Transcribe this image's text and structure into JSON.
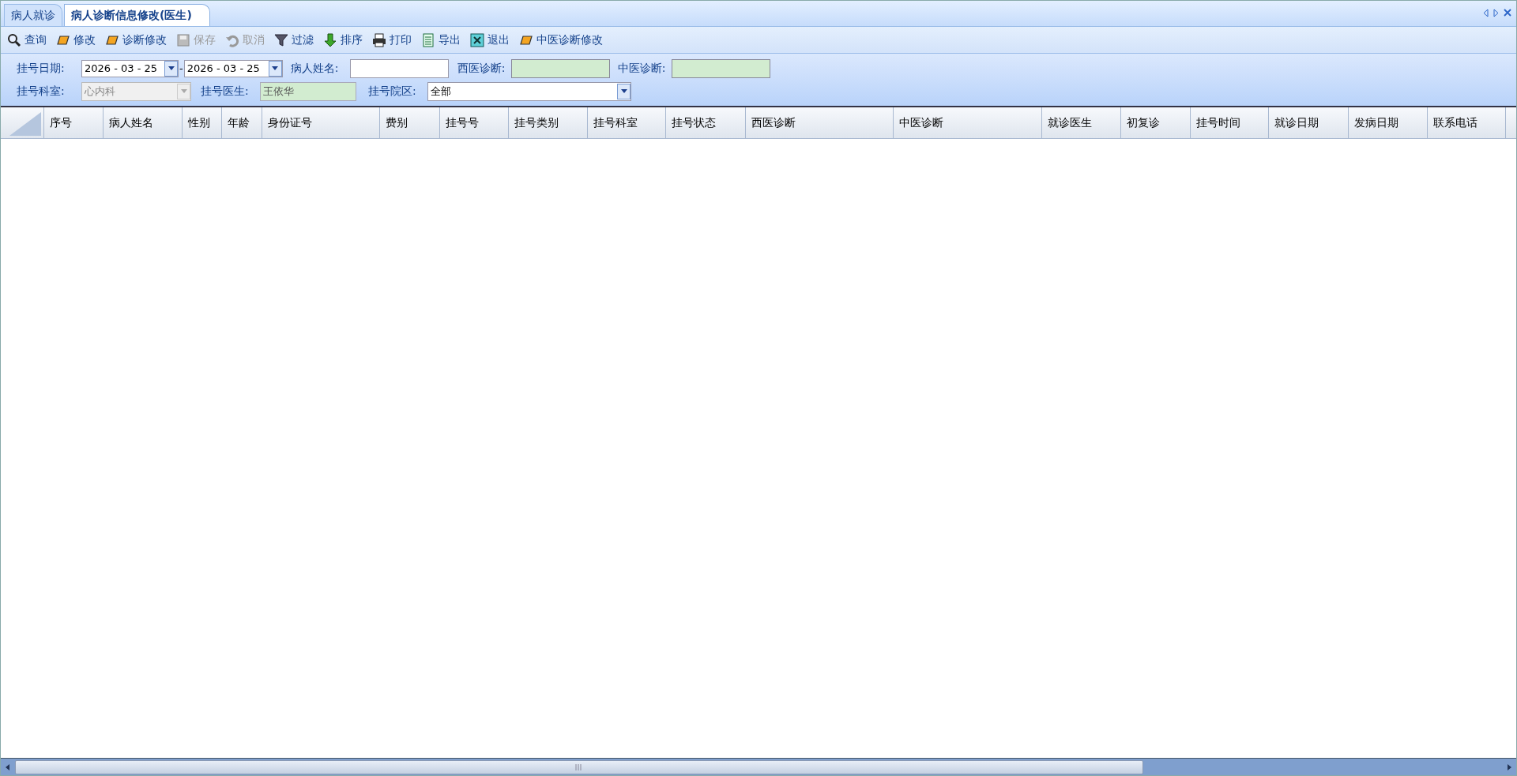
{
  "tabs": [
    {
      "label": "病人就诊",
      "selected": false
    },
    {
      "label": "病人诊断信息修改(医生)",
      "selected": true
    }
  ],
  "toolbar": [
    {
      "label": "查询",
      "kind": "search",
      "disabled": false
    },
    {
      "label": "修改",
      "kind": "edit",
      "disabled": false
    },
    {
      "label": "诊断修改",
      "kind": "edit",
      "disabled": false
    },
    {
      "label": "保存",
      "kind": "save",
      "disabled": true
    },
    {
      "label": "取消",
      "kind": "undo",
      "disabled": true
    },
    {
      "label": "过滤",
      "kind": "filter",
      "disabled": false
    },
    {
      "label": "排序",
      "kind": "sort",
      "disabled": false
    },
    {
      "label": "打印",
      "kind": "print",
      "disabled": false
    },
    {
      "label": "导出",
      "kind": "export",
      "disabled": false
    },
    {
      "label": "退出",
      "kind": "exit",
      "disabled": false
    },
    {
      "label": "中医诊断修改",
      "kind": "edit",
      "disabled": false
    }
  ],
  "filters": {
    "date_label": "挂号日期:",
    "date_from": "2026 - 03 - 25",
    "date_sep": "-",
    "date_to": "2026 - 03 - 25",
    "name_label": "病人姓名:",
    "western_label": "西医诊断:",
    "tcm_label": "中医诊断:",
    "dept_label": "挂号科室:",
    "dept_value": "心内科",
    "dept_disabled": true,
    "doctor_label": "挂号医生:",
    "doctor_value": "王依华",
    "campus_label": "挂号院区:",
    "campus_value": "全部"
  },
  "table": {
    "columns": [
      "序号",
      "病人姓名",
      "性别",
      "年龄",
      "身份证号",
      "费别",
      "挂号号",
      "挂号类别",
      "挂号科室",
      "挂号状态",
      "西医诊断",
      "中医诊断",
      "就诊医生",
      "初复诊",
      "挂号时间",
      "就诊日期",
      "发病日期",
      "联系电话"
    ]
  }
}
